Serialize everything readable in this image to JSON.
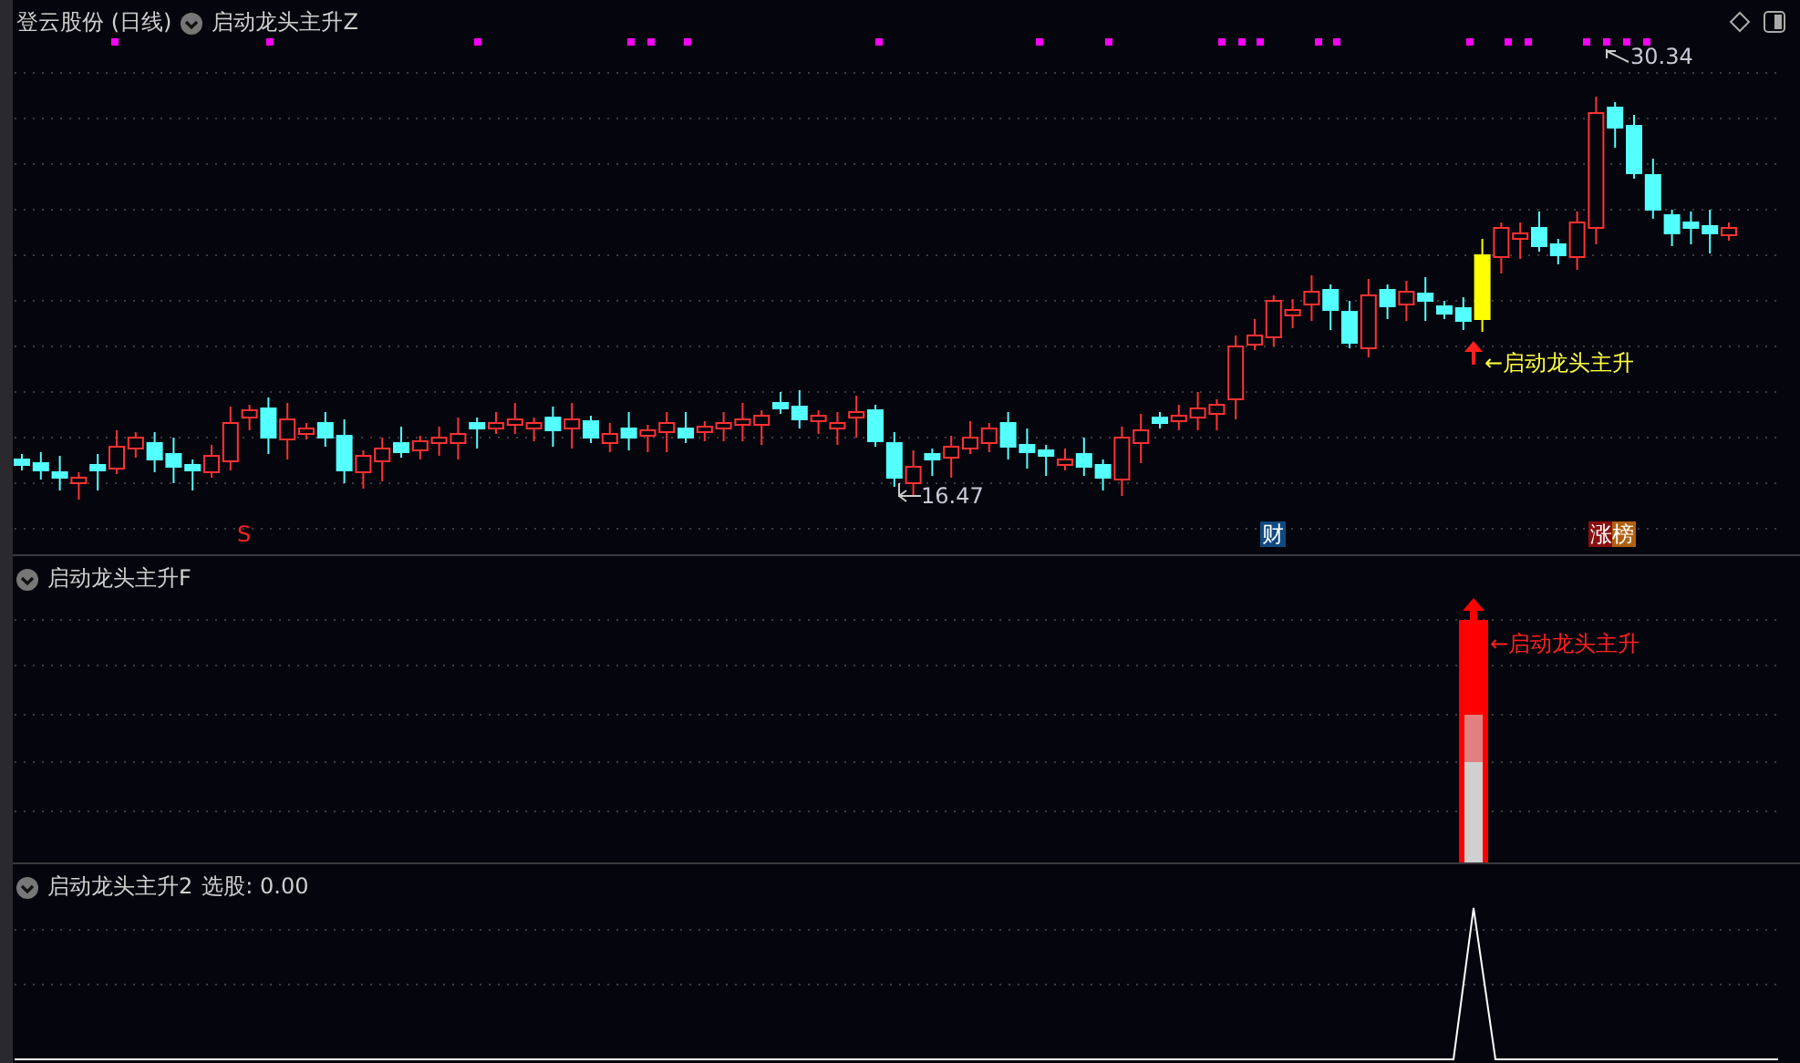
{
  "main_panel": {
    "stock_name": "登云股份 (日线)",
    "indicator": "启动龙头主升Z",
    "high_label": "30.34",
    "low_label": "16.47",
    "signal_label": "←启动龙头主升",
    "markers": [
      {
        "text": "S",
        "kind": "s"
      },
      {
        "text": "财",
        "kind": "finance"
      },
      {
        "text": "涨榜",
        "kind": "rank"
      }
    ]
  },
  "panel_2": {
    "indicator": "启动龙头主升F",
    "signal_label": "←启动龙头主升"
  },
  "panel_3": {
    "indicator": "启动龙头主升2",
    "reading": "选股: 0.00"
  }
}
